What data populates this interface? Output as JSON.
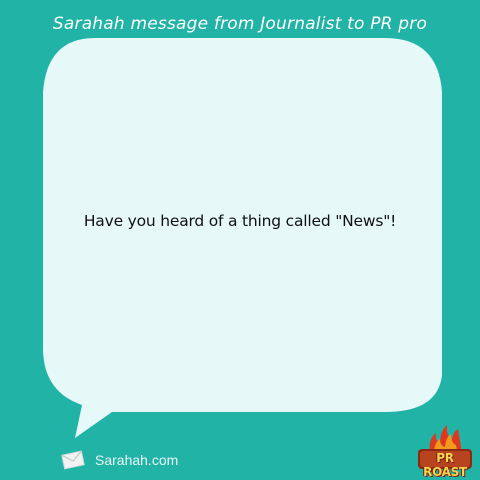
{
  "header": {
    "title": "Sarahah message from Journalist to PR pro"
  },
  "message": {
    "text": "Have you heard of a thing called \"News\"!"
  },
  "footer": {
    "site": "Sarahah.com",
    "icon": "envelope-icon"
  },
  "logo": {
    "text": "PR ROAST",
    "icon": "pr-roast-logo"
  },
  "colors": {
    "background": "#20b3a6",
    "bubble": "#e6f8f8",
    "text": "#111111",
    "heading": "#ffffff"
  }
}
